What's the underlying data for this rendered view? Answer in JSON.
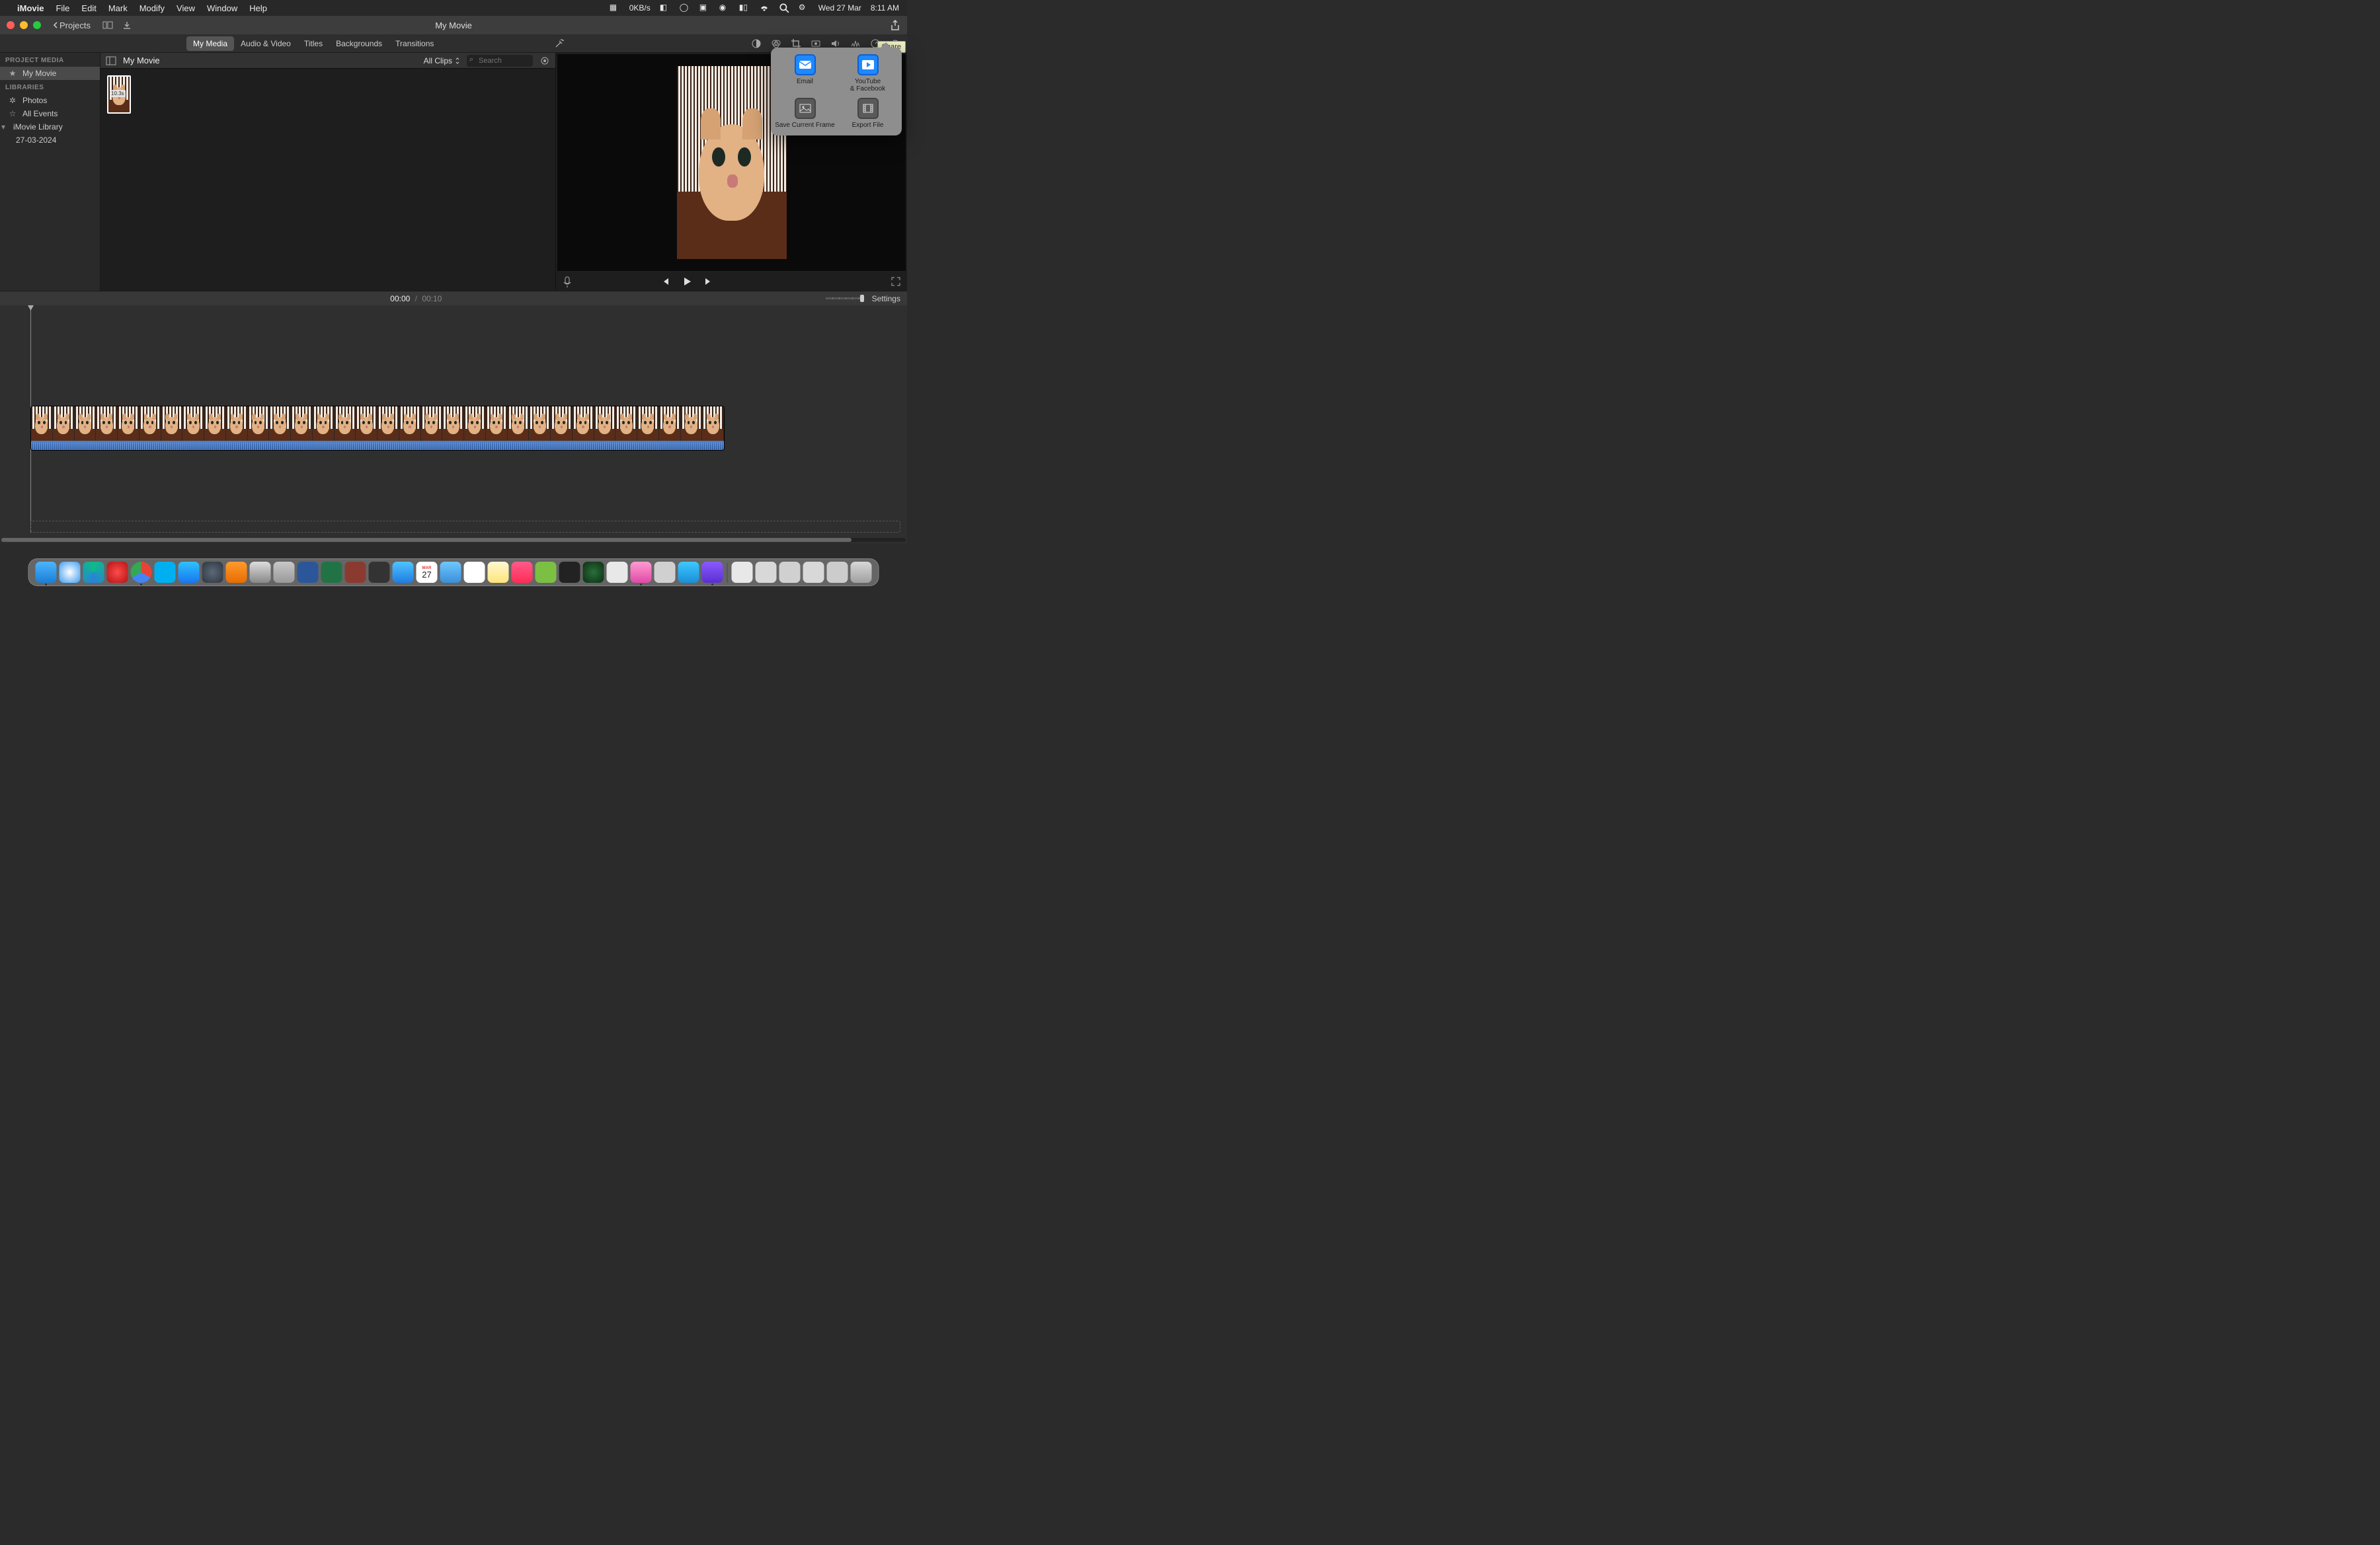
{
  "menubar": {
    "app": "iMovie",
    "items": [
      "File",
      "Edit",
      "Mark",
      "Modify",
      "View",
      "Window",
      "Help"
    ],
    "net_speed": "0KB/s",
    "date": "Wed 27 Mar",
    "time": "8:11 AM"
  },
  "titlebar": {
    "back_label": "Projects",
    "title": "My Movie"
  },
  "tabs": {
    "items": [
      "My Media",
      "Audio & Video",
      "Titles",
      "Backgrounds",
      "Transitions"
    ],
    "active": "My Media"
  },
  "sidebar": {
    "section1": "PROJECT MEDIA",
    "project": "My Movie",
    "section2": "LIBRARIES",
    "items": [
      "Photos",
      "All Events",
      "iMovie Library"
    ],
    "event": "27-03-2024"
  },
  "media": {
    "crumb": "My Movie",
    "filter": "All Clips",
    "search_placeholder": "Search",
    "clip_duration": "10.3s"
  },
  "viewer": {
    "tools": [
      "color-balance",
      "color-correction",
      "crop",
      "stabilize",
      "volume",
      "noise-reduction",
      "speed",
      "info"
    ]
  },
  "timeline": {
    "current": "00:00",
    "total": "00:10",
    "settings": "Settings"
  },
  "share": {
    "tooltip": "Share",
    "email": "Email",
    "youtube_l1": "YouTube",
    "youtube_l2": "& Facebook",
    "save_frame": "Save Current Frame",
    "export_file": "Export File"
  },
  "dock": {
    "calendar_month": "MAR",
    "calendar_day": "27"
  }
}
